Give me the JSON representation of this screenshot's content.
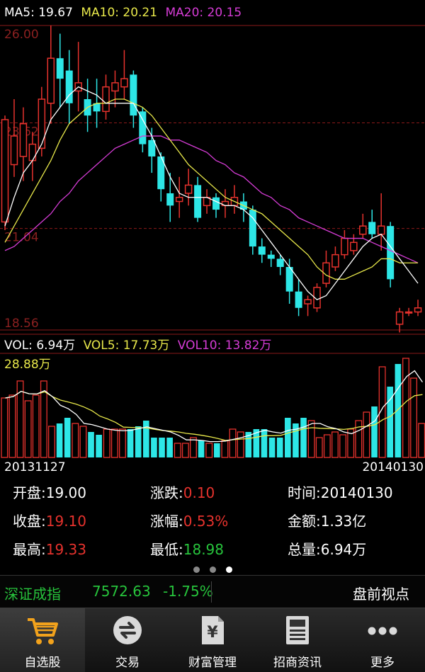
{
  "ma": {
    "ma5": "MA5: 19.67",
    "ma10": "MA10: 20.21",
    "ma20": "MA20: 20.15",
    "colors": {
      "ma5": "#ffffff",
      "ma10": "#e8e84a",
      "ma20": "#d63cd6"
    }
  },
  "price_axis": [
    "26.00",
    "23.62",
    "21.04",
    "18.56"
  ],
  "vol": {
    "vol": "VOL: 6.94万",
    "vol5": "VOL5: 17.73万",
    "vol10": "VOL10: 13.82万",
    "max": "28.88万"
  },
  "dates": {
    "start": "20131127",
    "end": "20140130"
  },
  "info": {
    "open_label": "开盘:",
    "open": "19.00",
    "close_label": "收盘:",
    "close": "19.10",
    "high_label": "最高:",
    "high": "19.33",
    "change_label": "涨跌:",
    "change": "0.10",
    "pct_label": "涨幅:",
    "pct": "0.53%",
    "low_label": "最低:",
    "low": "18.98",
    "time_label": "时间:",
    "time": "20140130",
    "amount_label": "金额:",
    "amount": "1.33亿",
    "volume_label": "总量:",
    "volume": "6.94万"
  },
  "ticker": {
    "name": "深证成指",
    "price": "7572.63",
    "pct": "-1.75%",
    "right": "盘前视点"
  },
  "tabs": [
    {
      "label": "自选股",
      "icon": "shopping-cart-icon"
    },
    {
      "label": "交易",
      "icon": "exchange-arrows-icon"
    },
    {
      "label": "财富管理",
      "icon": "yuan-document-icon"
    },
    {
      "label": "招商资讯",
      "icon": "newspaper-icon"
    },
    {
      "label": "更多",
      "icon": "more-dots-icon"
    }
  ],
  "colors": {
    "up": "#e6322d",
    "down": "#2de6e6",
    "grid": "#8b1a1a"
  },
  "chart_data": {
    "type": "candlestick",
    "y_range": [
      18.56,
      26.0
    ],
    "candles": [
      {
        "o": 21.2,
        "h": 23.8,
        "c": 23.7,
        "l": 21.0
      },
      {
        "o": 22.6,
        "h": 24.2,
        "c": 23.3,
        "l": 22.3
      },
      {
        "o": 22.8,
        "h": 24.0,
        "c": 23.6,
        "l": 22.2
      },
      {
        "o": 22.7,
        "h": 23.4,
        "c": 23.1,
        "l": 22.2
      },
      {
        "o": 23.0,
        "h": 24.5,
        "c": 24.2,
        "l": 22.8
      },
      {
        "o": 24.1,
        "h": 26.0,
        "c": 25.2,
        "l": 23.6
      },
      {
        "o": 25.2,
        "h": 25.8,
        "c": 24.7,
        "l": 24.0
      },
      {
        "o": 24.9,
        "h": 25.4,
        "c": 24.1,
        "l": 23.6
      },
      {
        "o": 24.4,
        "h": 25.6,
        "c": 24.6,
        "l": 23.9
      },
      {
        "o": 24.2,
        "h": 24.7,
        "c": 23.8,
        "l": 23.4
      },
      {
        "o": 24.1,
        "h": 24.7,
        "c": 23.9,
        "l": 23.5
      },
      {
        "o": 23.9,
        "h": 24.8,
        "c": 24.5,
        "l": 23.7
      },
      {
        "o": 24.4,
        "h": 24.9,
        "c": 24.6,
        "l": 24.0
      },
      {
        "o": 24.5,
        "h": 25.4,
        "c": 24.7,
        "l": 24.2
      },
      {
        "o": 24.8,
        "h": 24.9,
        "c": 23.8,
        "l": 23.5
      },
      {
        "o": 23.9,
        "h": 24.0,
        "c": 23.1,
        "l": 22.9
      },
      {
        "o": 23.2,
        "h": 23.5,
        "c": 22.8,
        "l": 22.4
      },
      {
        "o": 22.8,
        "h": 22.9,
        "c": 22.0,
        "l": 21.7
      },
      {
        "o": 21.9,
        "h": 22.4,
        "c": 21.6,
        "l": 21.2
      },
      {
        "o": 21.7,
        "h": 22.3,
        "c": 21.8,
        "l": 21.3
      },
      {
        "o": 21.9,
        "h": 22.5,
        "c": 22.1,
        "l": 21.6
      },
      {
        "o": 22.1,
        "h": 22.3,
        "c": 21.3,
        "l": 21.2
      },
      {
        "o": 21.6,
        "h": 22.0,
        "c": 21.8,
        "l": 21.4
      },
      {
        "o": 21.8,
        "h": 21.9,
        "c": 21.5,
        "l": 21.3
      },
      {
        "o": 21.6,
        "h": 22.0,
        "c": 21.7,
        "l": 21.3
      },
      {
        "o": 21.6,
        "h": 22.1,
        "c": 21.8,
        "l": 21.4
      },
      {
        "o": 21.7,
        "h": 21.9,
        "c": 21.5,
        "l": 21.2
      },
      {
        "o": 21.5,
        "h": 21.6,
        "c": 20.6,
        "l": 20.4
      },
      {
        "o": 20.6,
        "h": 20.8,
        "c": 20.4,
        "l": 20.2
      },
      {
        "o": 20.4,
        "h": 20.5,
        "c": 20.3,
        "l": 20.1
      },
      {
        "o": 20.3,
        "h": 20.4,
        "c": 20.1,
        "l": 19.9
      },
      {
        "o": 20.1,
        "h": 20.3,
        "c": 19.5,
        "l": 19.2
      },
      {
        "o": 19.5,
        "h": 19.8,
        "c": 19.1,
        "l": 18.9
      },
      {
        "o": 19.2,
        "h": 19.4,
        "c": 19.3,
        "l": 18.9
      },
      {
        "o": 19.1,
        "h": 19.7,
        "c": 19.6,
        "l": 19.0
      },
      {
        "o": 19.7,
        "h": 20.5,
        "c": 20.2,
        "l": 19.6
      },
      {
        "o": 20.1,
        "h": 20.6,
        "c": 20.4,
        "l": 20.0
      },
      {
        "o": 20.4,
        "h": 21.0,
        "c": 20.8,
        "l": 20.3
      },
      {
        "o": 20.5,
        "h": 20.9,
        "c": 20.7,
        "l": 20.4
      },
      {
        "o": 20.9,
        "h": 21.4,
        "c": 21.1,
        "l": 20.8
      },
      {
        "o": 21.2,
        "h": 21.5,
        "c": 20.9,
        "l": 20.8
      },
      {
        "o": 20.9,
        "h": 21.9,
        "c": 21.1,
        "l": 20.5
      },
      {
        "o": 21.1,
        "h": 21.2,
        "c": 19.8,
        "l": 19.6
      },
      {
        "o": 18.7,
        "h": 19.1,
        "c": 19.0,
        "l": 18.5
      },
      {
        "o": 19.0,
        "h": 19.1,
        "c": 19.0,
        "l": 18.9
      },
      {
        "o": 19.0,
        "h": 19.3,
        "c": 19.1,
        "l": 18.9
      }
    ],
    "ma5": [
      21.1,
      21.8,
      22.4,
      22.7,
      23.1,
      23.7,
      24.0,
      24.3,
      24.5,
      24.4,
      24.3,
      24.1,
      24.1,
      24.1,
      24.1,
      23.7,
      23.3,
      22.8,
      22.3,
      21.9,
      21.8,
      21.8,
      21.8,
      21.7,
      21.6,
      21.6,
      21.5,
      21.3,
      21.0,
      20.7,
      20.4,
      20.1,
      19.8,
      19.5,
      19.3,
      19.4,
      19.7,
      20.0,
      20.3,
      20.6,
      20.8,
      20.9,
      20.6,
      20.3,
      20.0,
      19.7
    ],
    "ma10": [
      20.7,
      21.1,
      21.5,
      21.9,
      22.3,
      22.7,
      23.2,
      23.6,
      23.8,
      24.0,
      24.1,
      24.1,
      24.2,
      24.2,
      24.1,
      24.0,
      23.8,
      23.5,
      23.2,
      22.9,
      22.6,
      22.4,
      22.2,
      22.0,
      21.8,
      21.7,
      21.6,
      21.5,
      21.4,
      21.2,
      21.0,
      20.8,
      20.6,
      20.4,
      20.1,
      19.9,
      19.8,
      19.8,
      19.9,
      20.0,
      20.1,
      20.3,
      20.3,
      20.2,
      20.2,
      20.2
    ],
    "ma20": [
      20.5,
      20.6,
      20.8,
      21.0,
      21.2,
      21.4,
      21.7,
      21.9,
      22.2,
      22.4,
      22.6,
      22.8,
      23.0,
      23.1,
      23.2,
      23.3,
      23.3,
      23.3,
      23.2,
      23.2,
      23.1,
      23.0,
      22.9,
      22.7,
      22.6,
      22.4,
      22.3,
      22.1,
      21.9,
      21.8,
      21.6,
      21.5,
      21.3,
      21.2,
      21.1,
      21.0,
      20.9,
      20.8,
      20.8,
      20.8,
      20.7,
      20.6,
      20.5,
      20.4,
      20.3,
      20.2
    ],
    "volume": [
      21,
      22,
      27,
      20,
      22,
      27,
      11,
      12,
      14,
      12,
      11,
      9,
      8,
      10,
      10,
      10,
      10,
      11,
      13,
      7,
      7,
      7,
      5,
      5,
      7,
      6,
      5,
      5,
      6,
      10,
      9,
      9,
      10,
      10,
      7,
      7,
      14,
      12,
      14,
      13,
      7,
      8,
      9,
      8,
      10,
      13,
      16,
      18,
      32,
      25,
      33,
      35,
      28,
      12
    ]
  }
}
